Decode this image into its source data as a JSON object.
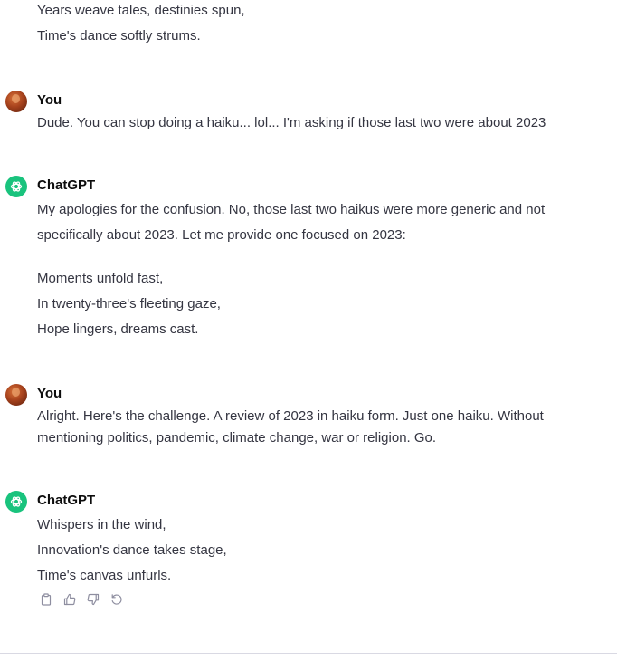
{
  "messages": [
    {
      "role": "assistant_partial",
      "lines": [
        "Years weave tales, destinies spun,",
        "Time's dance softly strums."
      ]
    },
    {
      "role": "user",
      "author": "You",
      "lines": [
        "Dude. You can stop doing a haiku... lol... I'm asking if those last two were about 2023"
      ]
    },
    {
      "role": "assistant",
      "author": "ChatGPT",
      "lines": [
        "My apologies for the confusion. No, those last two haikus were more generic and not",
        "specifically about 2023. Let me provide one focused on 2023:",
        "Moments unfold fast,",
        "In twenty-three's fleeting gaze,",
        "Hope lingers, dreams cast."
      ]
    },
    {
      "role": "user",
      "author": "You",
      "lines": [
        "Alright. Here's the challenge. A review of 2023 in haiku form. Just one haiku. Without",
        "mentioning politics, pandemic, climate change, war or religion. Go."
      ]
    },
    {
      "role": "assistant",
      "author": "ChatGPT",
      "lines": [
        "Whispers in the wind,",
        "Innovation's dance takes stage,",
        "Time's canvas unfurls."
      ]
    }
  ],
  "actions": [
    {
      "icon": "clipboard-icon"
    },
    {
      "icon": "thumbs-up-icon"
    },
    {
      "icon": "thumbs-down-icon"
    },
    {
      "icon": "regenerate-icon"
    }
  ],
  "colors": {
    "text": "#343541",
    "author": "#0d0d0d",
    "gpt_avatar": "#19c37d",
    "icon": "#8e8ea0",
    "divider": "#d9d9e3"
  }
}
